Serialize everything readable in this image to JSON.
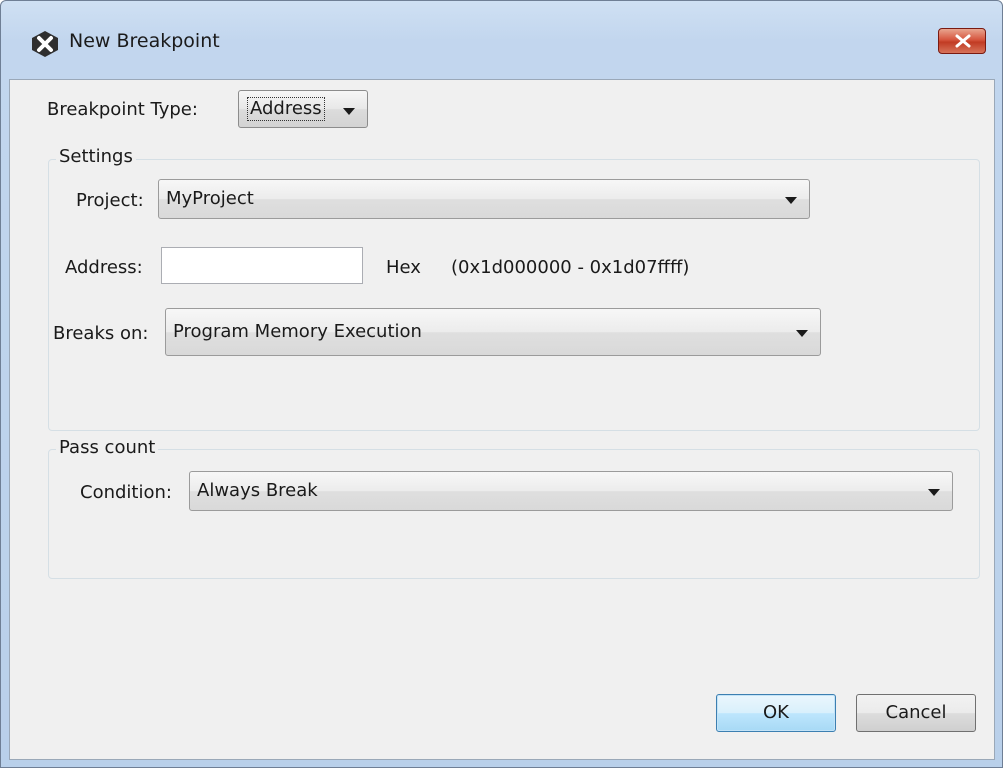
{
  "window": {
    "title": "New Breakpoint",
    "icon": "netbeans-x-icon",
    "close_icon": "close-x-icon"
  },
  "breakpoint_type": {
    "label": "Breakpoint Type:",
    "value": "Address"
  },
  "settings": {
    "group_label": "Settings",
    "project_label": "Project:",
    "project_value": "MyProject",
    "address_label": "Address:",
    "address_value": "",
    "hex_label": "Hex",
    "range_text": "(0x1d000000 - 0x1d07ffff)",
    "breaks_on_label": "Breaks on:",
    "breaks_on_value": "Program Memory Execution"
  },
  "pass_count": {
    "group_label": "Pass count",
    "condition_label": "Condition:",
    "condition_value": "Always Break"
  },
  "buttons": {
    "ok": "OK",
    "cancel": "Cancel"
  }
}
